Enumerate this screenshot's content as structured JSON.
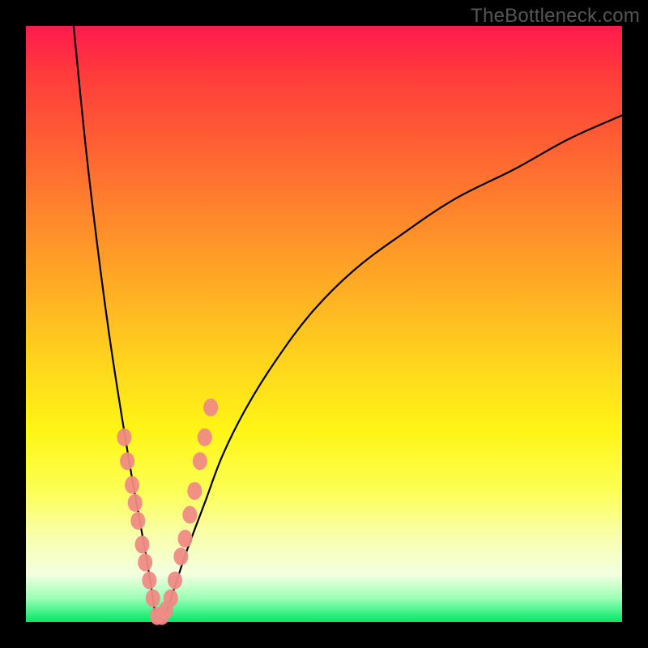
{
  "watermark": {
    "text": "TheBottleneck.com"
  },
  "colors": {
    "frame": "#000000",
    "curve": "#000000",
    "marker": "#ef8b85",
    "gradient_stops": [
      "#ff1a4d",
      "#ff3b3b",
      "#ff5a34",
      "#ff7a2e",
      "#ff9a28",
      "#ffba22",
      "#ffd91c",
      "#fff516",
      "#fcff55",
      "#f8ffb0",
      "#f4ffe0",
      "#9bffb8",
      "#00e866"
    ]
  },
  "chart_data": {
    "type": "line",
    "title": "",
    "xlabel": "",
    "ylabel": "",
    "xlim": [
      0,
      100
    ],
    "ylim": [
      0,
      100
    ],
    "grid": false,
    "legend": false,
    "annotations": [
      "TheBottleneck.com"
    ],
    "description": "V-shaped bottleneck curve over vertical rainbow gradient; minimum near x≈22, y≈0. Left branch rises steeply to y=100 at x≈8; right branch rises with decelerating slope to y≈85 at x=100.",
    "series": [
      {
        "name": "bottleneck-curve",
        "x": [
          8,
          10,
          12,
          14,
          16,
          18,
          20,
          21,
          22,
          23,
          24,
          25,
          27,
          30,
          33,
          37,
          42,
          48,
          55,
          63,
          72,
          82,
          91,
          100
        ],
        "y": [
          100,
          80,
          63,
          48,
          35,
          23,
          12,
          6,
          0,
          0,
          3,
          6,
          12,
          20,
          28,
          36,
          44,
          52,
          59,
          65,
          71,
          76,
          81,
          85
        ]
      }
    ],
    "markers": {
      "name": "highlighted-points",
      "color": "#ef8b85",
      "x": [
        16.5,
        17.0,
        17.8,
        18.3,
        18.8,
        19.5,
        20.0,
        20.7,
        21.3,
        22.0,
        22.8,
        23.5,
        24.3,
        25.0,
        26.0,
        26.7,
        27.5,
        28.3,
        29.2,
        30.0,
        31.0
      ],
      "y": [
        31,
        27,
        23,
        20,
        17,
        13,
        10,
        7,
        4,
        1,
        1,
        2,
        4,
        7,
        11,
        14,
        18,
        22,
        27,
        31,
        36
      ]
    }
  }
}
